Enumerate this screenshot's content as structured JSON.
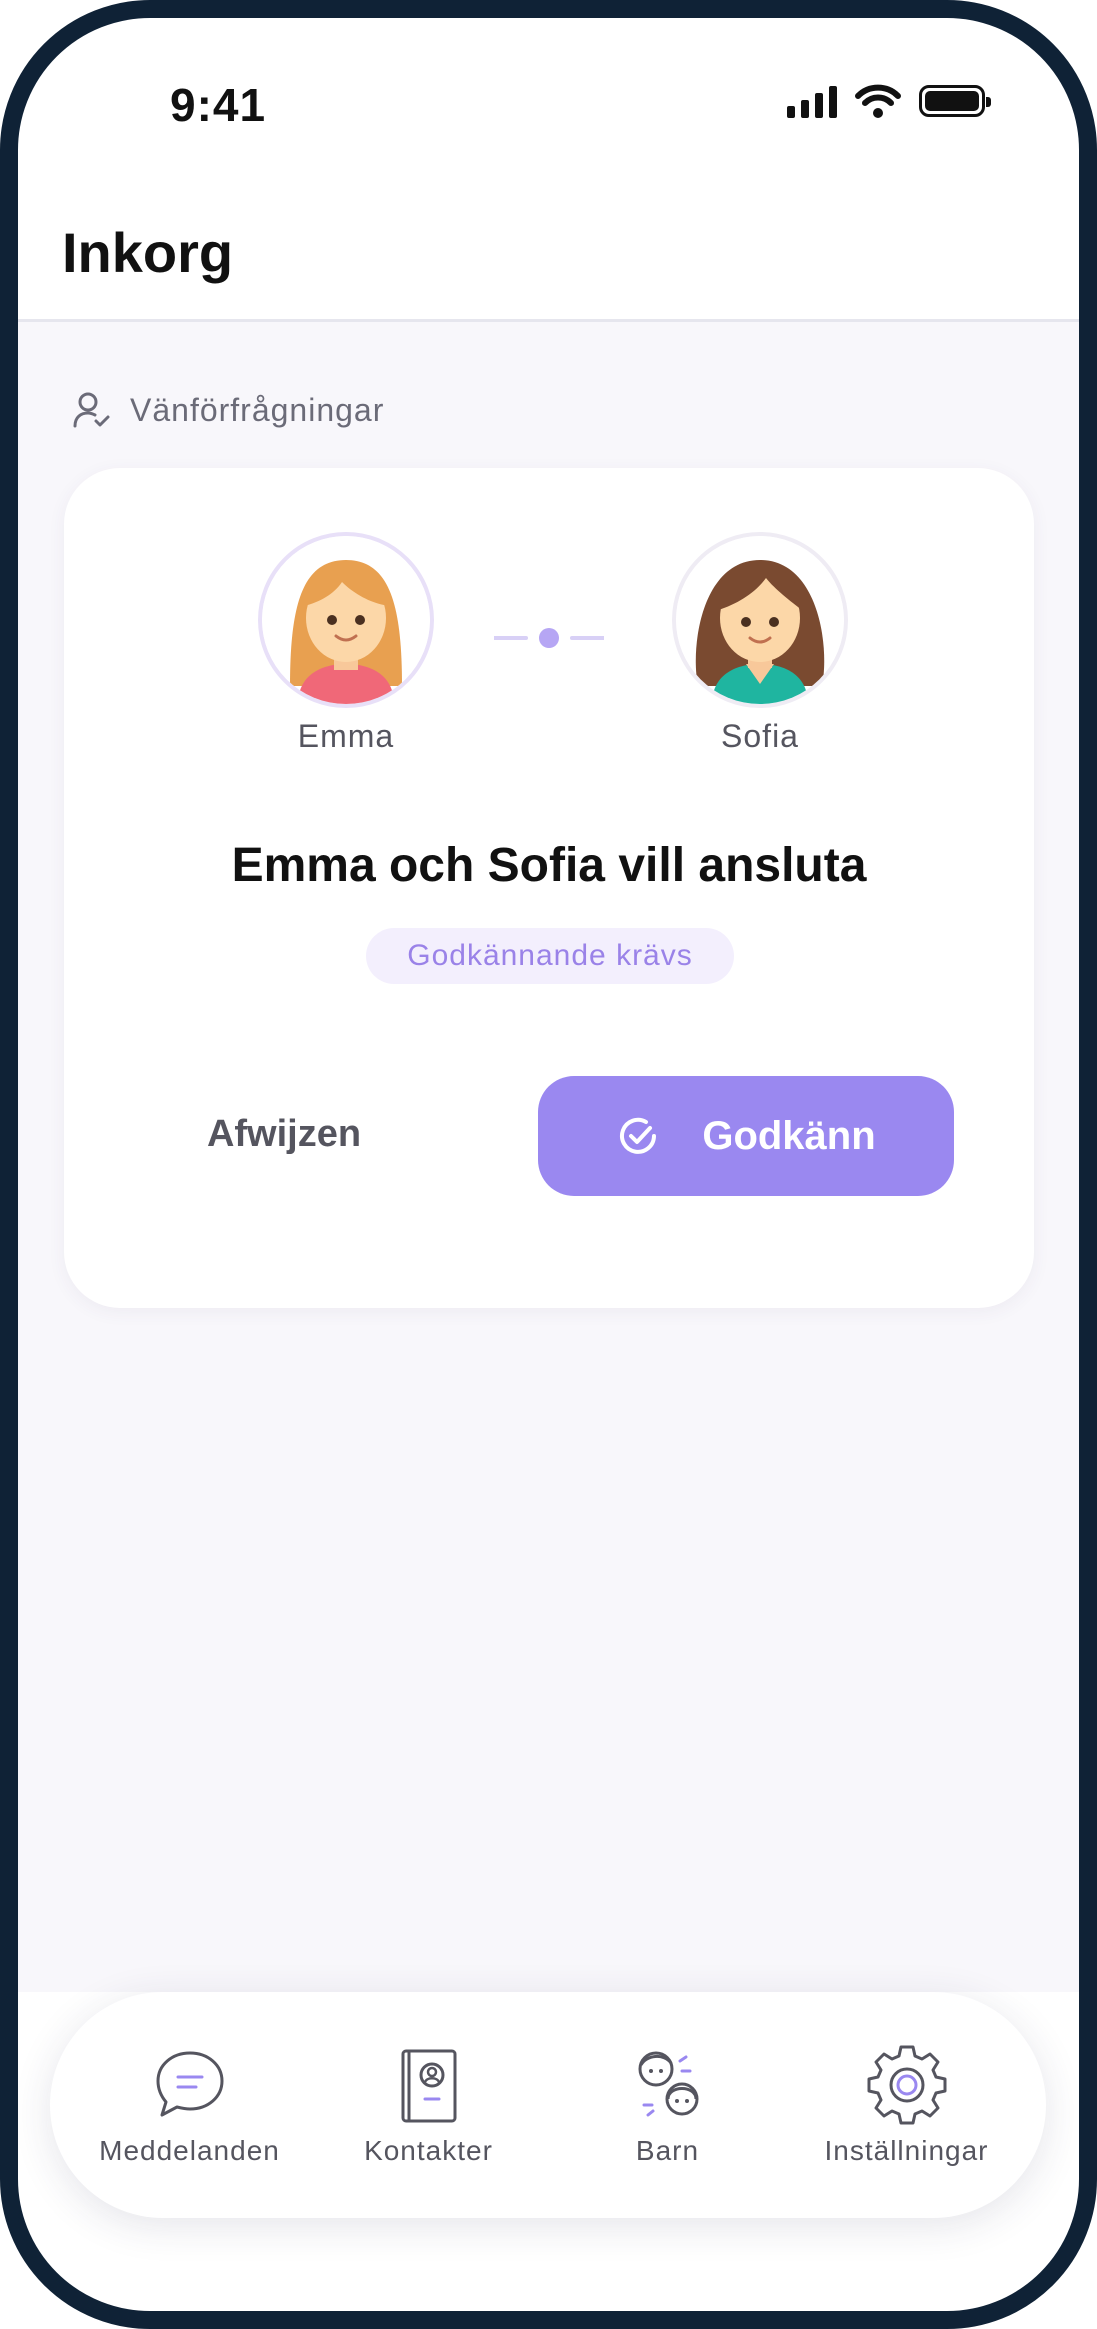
{
  "status_bar": {
    "time": "9:41"
  },
  "header": {
    "title": "Inkorg"
  },
  "section": {
    "label": "Vänförfrågningar"
  },
  "request_card": {
    "person_a": "Emma",
    "person_b": "Sofia",
    "title": "Emma och Sofia vill ansluta",
    "badge": "Godkännande krävs",
    "reject_label": "Afwijzen",
    "approve_label": "Godkänn"
  },
  "tabbar": {
    "items": [
      {
        "label": "Meddelanden",
        "icon": "chat-icon"
      },
      {
        "label": "Kontakter",
        "icon": "contacts-book-icon"
      },
      {
        "label": "Barn",
        "icon": "children-icon"
      },
      {
        "label": "Inställningar",
        "icon": "gear-icon"
      }
    ]
  },
  "colors": {
    "accent": "#9a88f0",
    "badge_bg": "#f3effd",
    "bezel": "#0f2236"
  }
}
